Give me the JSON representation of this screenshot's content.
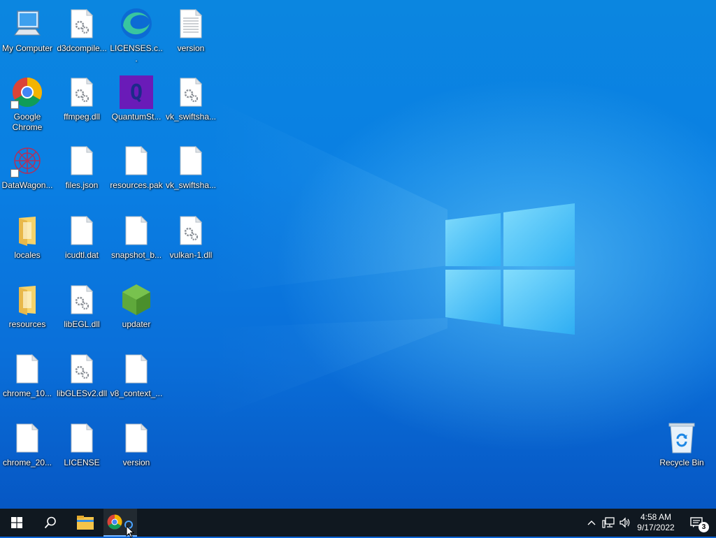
{
  "desktop": {
    "icons": [
      {
        "label": "My Computer",
        "type": "computer"
      },
      {
        "label": "d3dcompile...",
        "type": "dll"
      },
      {
        "label": "LICENSES.c...",
        "type": "edge"
      },
      {
        "label": "version",
        "type": "text"
      },
      {
        "label": "Google Chrome",
        "type": "chrome"
      },
      {
        "label": "ffmpeg.dll",
        "type": "dll"
      },
      {
        "label": "QuantumSt...",
        "type": "quantum"
      },
      {
        "label": "vk_swiftsha...",
        "type": "dll"
      },
      {
        "label": "DataWagon...",
        "type": "datawagon"
      },
      {
        "label": "files.json",
        "type": "blank"
      },
      {
        "label": "resources.pak",
        "type": "blank"
      },
      {
        "label": "vk_swiftsha...",
        "type": "blank"
      },
      {
        "label": "locales",
        "type": "folder"
      },
      {
        "label": "icudtl.dat",
        "type": "blank"
      },
      {
        "label": "snapshot_b...",
        "type": "blank"
      },
      {
        "label": "vulkan-1.dll",
        "type": "dll"
      },
      {
        "label": "resources",
        "type": "folder"
      },
      {
        "label": "libEGL.dll",
        "type": "dll"
      },
      {
        "label": "updater",
        "type": "updater"
      },
      {
        "label": "chrome_10...",
        "type": "blank"
      },
      {
        "label": "libGLESv2.dll",
        "type": "dll"
      },
      {
        "label": "v8_context_...",
        "type": "blank"
      },
      {
        "label": "chrome_20...",
        "type": "blank"
      },
      {
        "label": "LICENSE",
        "type": "blank"
      },
      {
        "label": "version",
        "type": "blank"
      },
      {
        "label": "Recycle Bin",
        "type": "recycle"
      }
    ]
  },
  "taskbar": {
    "clock_time": "4:58 AM",
    "clock_date": "9/17/2022",
    "notification_count": "3",
    "quantum_letter": "Q"
  },
  "colors": {
    "taskbar_bg": "#101820",
    "accent": "#79b8ff",
    "desktop_blue": "#0a7fe3"
  }
}
